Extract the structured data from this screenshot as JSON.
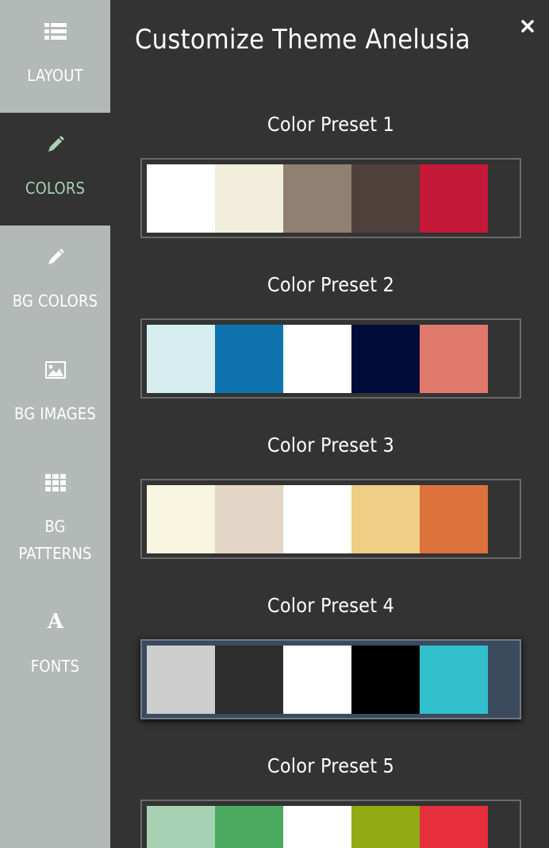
{
  "sidebar": {
    "items": [
      {
        "label": "LAYOUT",
        "icon": "list-icon",
        "active": false
      },
      {
        "label": "COLORS",
        "icon": "pencil-icon",
        "active": true
      },
      {
        "label": "BG COLORS",
        "icon": "pencil-icon",
        "active": false
      },
      {
        "label": "BG IMAGES",
        "icon": "image-icon",
        "active": false
      },
      {
        "label_line1": "BG",
        "label_line2": "PATTERNS",
        "icon": "grid-icon",
        "active": false
      },
      {
        "label": "FONTS",
        "icon": "font-icon",
        "active": false
      }
    ],
    "background": "#b3b9b6",
    "active_color": "#a8d1b4"
  },
  "header": {
    "title": "Customize Theme Anelusia",
    "close_icon": "close-icon"
  },
  "presets": [
    {
      "title": "Color Preset 1",
      "colors": [
        "#ffffff",
        "#f1efdc",
        "#8f8071",
        "#4f403c",
        "#c41837"
      ]
    },
    {
      "title": "Color Preset 2",
      "colors": [
        "#d6eef0",
        "#0f73ae",
        "#ffffff",
        "#020c3b",
        "#e07a6d"
      ]
    },
    {
      "title": "Color Preset 3",
      "colors": [
        "#f8f5e0",
        "#e3d6c7",
        "#ffffff",
        "#eecf85",
        "#dd723d"
      ]
    },
    {
      "title": "Color Preset 4",
      "colors": [
        "#cdcdcd",
        "#2d2d2d",
        "#ffffff",
        "#000000",
        "#31c0cb"
      ],
      "hovered": true
    },
    {
      "title": "Color Preset 5",
      "colors": [
        "#a8d1b3",
        "#4cab61",
        "#ffffff",
        "#92aa14",
        "#e62e3c"
      ]
    }
  ]
}
